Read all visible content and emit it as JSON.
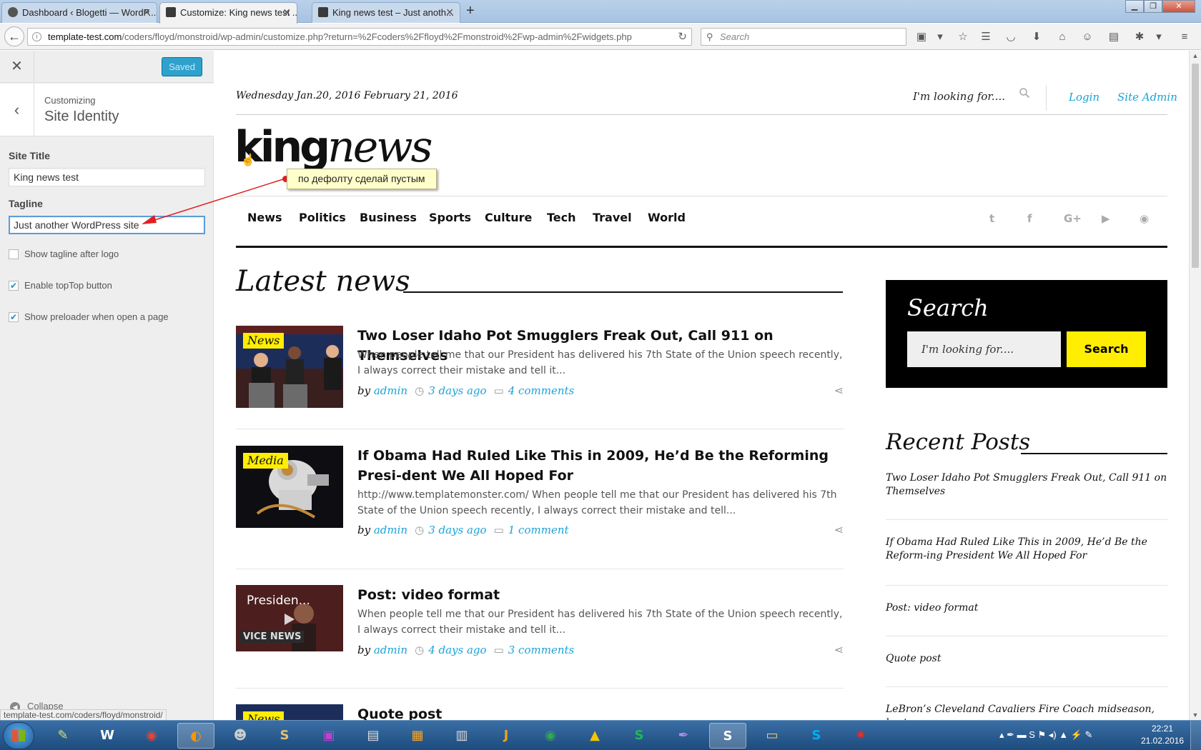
{
  "browser": {
    "tabs": [
      {
        "title": "Dashboard ‹ Blogetti — WordP...",
        "icon": "wordpress-icon"
      },
      {
        "title": "Customize: King news test ...",
        "icon": "kingnews-icon"
      },
      {
        "title": "King news test – Just anoth...",
        "icon": "kingnews-icon"
      }
    ],
    "active_tab": 1,
    "url_host": "template-test.com",
    "url_path": "/coders/floyd/monstroid/wp-admin/customize.php?return=%2Fcoders%2Ffloyd%2Fmonstroid%2Fwp-admin%2Fwidgets.php",
    "search_placeholder": "Search",
    "status_url": "template-test.com/coders/floyd/monstroid/"
  },
  "customizer": {
    "saved_label": "Saved",
    "subheading": "Customizing",
    "section_title": "Site Identity",
    "site_title_label": "Site Title",
    "site_title_value": "King news test",
    "tagline_label": "Tagline",
    "tagline_value": "Just another WordPress site",
    "checkboxes": [
      {
        "label": "Show tagline after logo",
        "checked": false
      },
      {
        "label": "Enable topTop button",
        "checked": true
      },
      {
        "label": "Show preloader when open a page",
        "checked": true
      }
    ],
    "collapse_label": "Collapse"
  },
  "annotation": {
    "text": "по дефолту сделай пустым",
    "color": "#e02020"
  },
  "site": {
    "date": "Wednesday Jan.20, 2016 February 21, 2016",
    "search_label": "I'm looking for....",
    "login": "Login",
    "site_admin": "Site Admin",
    "logo_bold": "king",
    "logo_italic": "news",
    "menu": [
      "News",
      "Politics",
      "Business",
      "Sports",
      "Culture",
      "Tech",
      "Travel",
      "World"
    ],
    "social_icons": [
      "twitter-icon",
      "facebook-icon",
      "google-plus-icon",
      "youtube-icon",
      "rss-icon"
    ],
    "latest_heading": "Latest news",
    "posts": [
      {
        "category": "News",
        "title": "Two Loser Idaho Pot Smugglers Freak Out, Call 911 on Themselves",
        "excerpt": "When people tell me that our President has delivered his 7th State of the Union speech recently, I always correct their mistake and tell it...",
        "by": "by",
        "author": "admin",
        "time": "3 days ago",
        "comments": "4 comments"
      },
      {
        "category": "Media",
        "title": "If Obama Had Ruled Like This in 2009, He’d Be the Reforming Presi-dent We All Hoped For",
        "excerpt": "http://www.templatemonster.com/ When people tell me that our President has delivered his 7th State of the Union speech recently, I always correct their mistake and tell...",
        "by": "by",
        "author": "admin",
        "time": "3 days ago",
        "comments": "1 comment"
      },
      {
        "category": "",
        "video_caption": "Presiden...",
        "video_brand": "VICE NEWS",
        "title": "Post: video format",
        "excerpt": "When people tell me that our President has delivered his 7th State of the Union speech recently, I always correct their mistake and tell it...",
        "by": "by",
        "author": "admin",
        "time": "4 days ago",
        "comments": "3 comments"
      },
      {
        "category": "News",
        "title": "Quote post"
      }
    ],
    "search_widget": {
      "title": "Search",
      "placeholder": "I'm looking for....",
      "button": "Search"
    },
    "recent_heading": "Recent Posts",
    "recent_posts": [
      "Two Loser Idaho Pot Smugglers Freak Out, Call 911 on Themselves",
      "If Obama Had Ruled Like This in 2009, He’d Be the Reform-ing President We All Hoped For",
      "Post: video format",
      "Quote post",
      "LeBron’s Cleveland Cavaliers Fire Coach midseason, best"
    ]
  },
  "taskbar": {
    "clock_time": "22:21",
    "clock_date": "21.02.2016"
  },
  "colors": {
    "accent_link": "#1aa3d9",
    "badge_yellow": "#ffee00",
    "wp_blue": "#2ea2cc"
  }
}
